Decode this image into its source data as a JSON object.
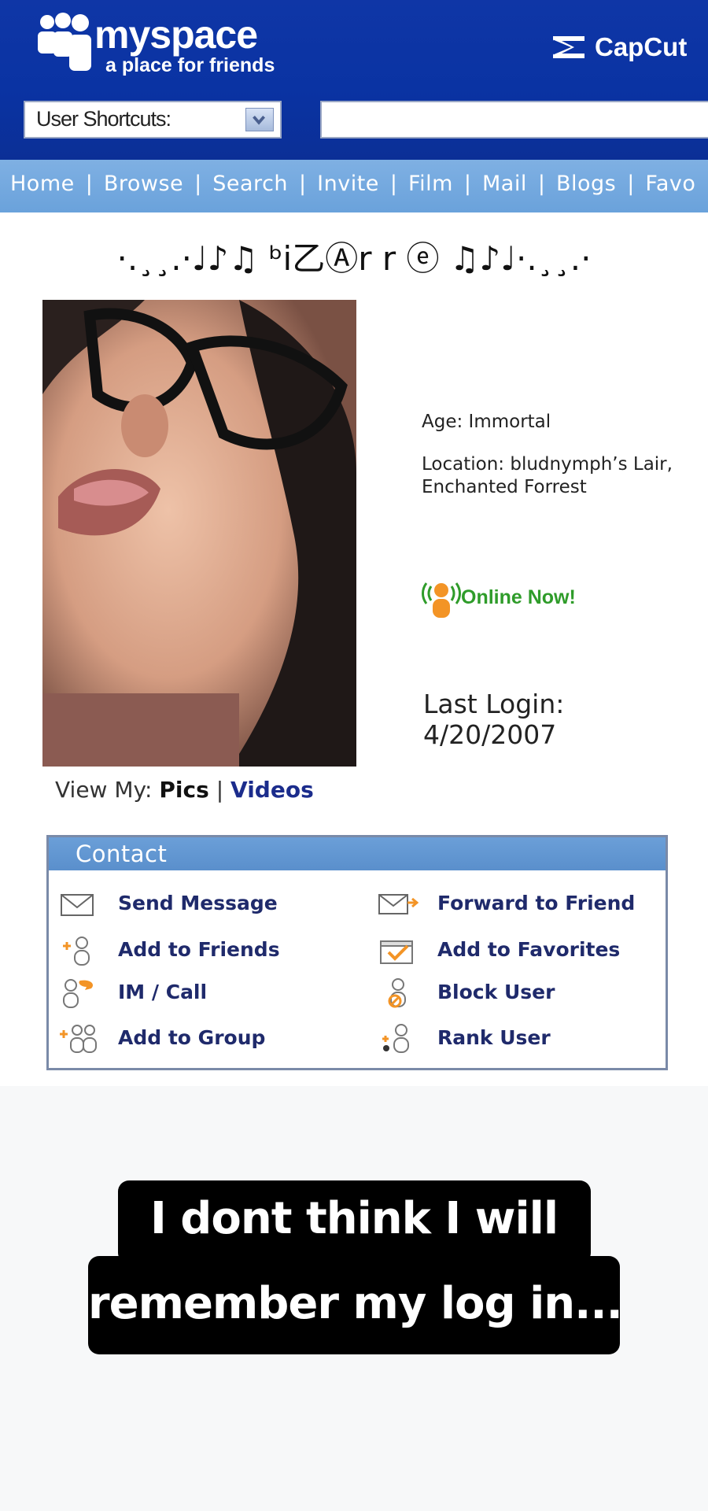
{
  "header": {
    "logo_text": "myspace",
    "tagline": "a place for friends",
    "watermark": "CapCut",
    "shortcuts_label": "User Shortcuts:",
    "search_value": ""
  },
  "nav": {
    "items": [
      "Home",
      "Browse",
      "Search",
      "Invite",
      "Film",
      "Mail",
      "Blogs",
      "Favo"
    ]
  },
  "profile": {
    "display_name": "·.¸¸.·♩♪♫ ᵇi乙Ⓐr r ⓔ ♫♪♩·.¸¸.·",
    "age": "Age: Immortal",
    "location_line1": "Location: bludnymph’s Lair,",
    "location_line2": "Enchanted Forrest",
    "online_status": "Online Now!",
    "last_login_label": "Last Login:",
    "last_login_date": "4/20/2007",
    "view_my_label": "View My:",
    "view_pics": "Pics",
    "view_sep": "|",
    "view_videos": "Videos"
  },
  "contact": {
    "title": "Contact",
    "items": [
      {
        "label": "Send Message",
        "icon": "envelope-icon"
      },
      {
        "label": "Forward to Friend",
        "icon": "forward-envelope-icon"
      },
      {
        "label": "Add to Friends",
        "icon": "add-friend-icon"
      },
      {
        "label": "Add to Favorites",
        "icon": "favorites-icon"
      },
      {
        "label": "IM / Call",
        "icon": "im-call-icon"
      },
      {
        "label": "Block User",
        "icon": "block-user-icon"
      },
      {
        "label": "Add to Group",
        "icon": "add-group-icon"
      },
      {
        "label": "Rank User",
        "icon": "rank-user-icon"
      }
    ]
  },
  "caption": {
    "line1": "I dont think I will",
    "line2": "remember my log in..."
  },
  "colors": {
    "header_blue": "#0a33a3",
    "nav_blue": "#6aa2db",
    "online_green": "#2f9c2a",
    "online_orange": "#f39426"
  }
}
